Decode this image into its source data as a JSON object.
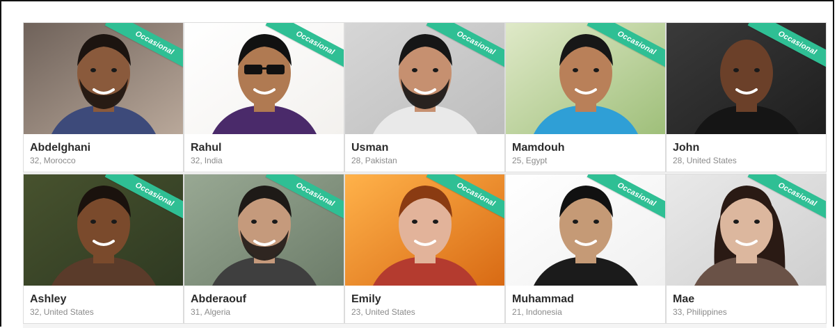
{
  "badge_label": "Occasional",
  "colors": {
    "badge": "#2fbf94",
    "name_text": "#2b2b2b",
    "meta_text": "#8a8a8a"
  },
  "profiles": [
    {
      "name": "Abdelghani",
      "age": "32",
      "location": "Morocco",
      "bg": "#b9a89a",
      "bg2": "#6f625a",
      "skin": "#8a5a3c",
      "hair": "#1c1410",
      "shirt": "#3d4a7a",
      "accessory": "beard"
    },
    {
      "name": "Rahul",
      "age": "32",
      "location": "India",
      "bg": "#f3f1ee",
      "bg2": "#ffffff",
      "skin": "#b07a52",
      "hair": "#111111",
      "shirt": "#4a2a6a",
      "accessory": "sunglasses"
    },
    {
      "name": "Usman",
      "age": "28",
      "location": "Pakistan",
      "bg": "#bdbdbd",
      "bg2": "#d6d6d6",
      "skin": "#c69070",
      "hair": "#161616",
      "shirt": "#e9e9e9",
      "accessory": "beard"
    },
    {
      "name": "Mamdouh",
      "age": "25",
      "location": "Egypt",
      "bg": "#9fbf7a",
      "bg2": "#dfe9c8",
      "skin": "#b98059",
      "hair": "#171717",
      "shirt": "#2f9fd6",
      "accessory": "none"
    },
    {
      "name": "John",
      "age": "28",
      "location": "United States",
      "bg": "#1e1e1e",
      "bg2": "#3a3a3a",
      "skin": "#6b4029",
      "hair": "#2a1a12",
      "shirt": "#151515",
      "accessory": "bald"
    },
    {
      "name": "Ashley",
      "age": "32",
      "location": "United States",
      "bg": "#2f3a22",
      "bg2": "#47522e",
      "skin": "#7a4a2c",
      "hair": "#1a120d",
      "shirt": "#5a3b2a",
      "accessory": "none"
    },
    {
      "name": "Abderaouf",
      "age": "31",
      "location": "Algeria",
      "bg": "#6d7d6a",
      "bg2": "#98a893",
      "skin": "#c59a7c",
      "hair": "#1e1a17",
      "shirt": "#3f3f3f",
      "accessory": "beard"
    },
    {
      "name": "Emily",
      "age": "23",
      "location": "United States",
      "bg": "#d86a14",
      "bg2": "#ffb24a",
      "skin": "#e2b39a",
      "hair": "#8a3b12",
      "shirt": "#b43b2f",
      "accessory": "none"
    },
    {
      "name": "Muhammad",
      "age": "21",
      "location": "Indonesia",
      "bg": "#f0f0f0",
      "bg2": "#ffffff",
      "skin": "#c59a76",
      "hair": "#111111",
      "shirt": "#1b1b1b",
      "accessory": "none"
    },
    {
      "name": "Mae",
      "age": "33",
      "location": "Philippines",
      "bg": "#cfcfcf",
      "bg2": "#e9e9e9",
      "skin": "#dcb79e",
      "hair": "#2a1a14",
      "shirt": "#6a5247",
      "accessory": "longhair"
    }
  ]
}
